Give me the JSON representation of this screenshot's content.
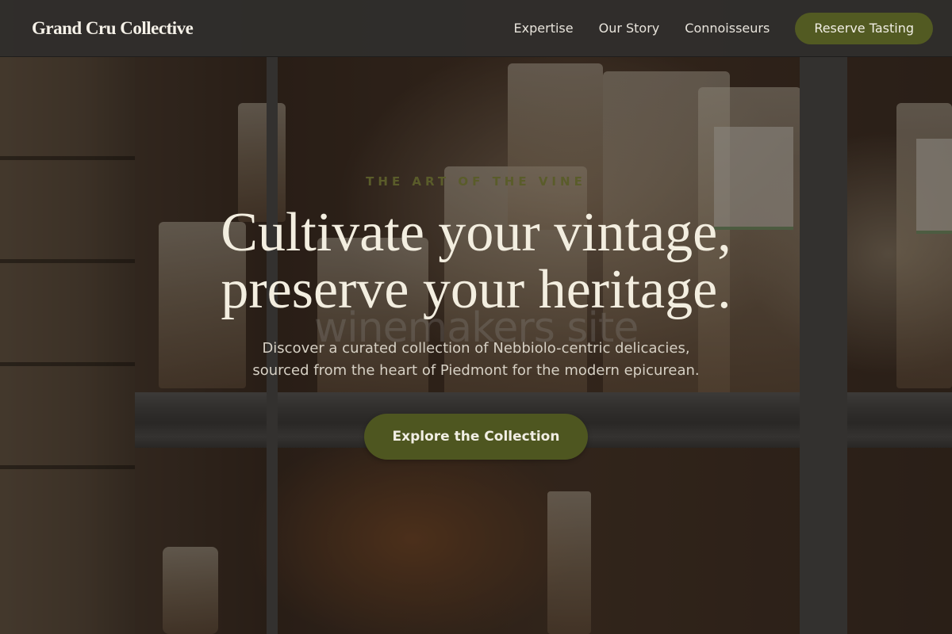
{
  "header": {
    "brand": "Grand Cru Collective",
    "nav": [
      {
        "label": "Expertise"
      },
      {
        "label": "Our Story"
      },
      {
        "label": "Connoisseurs"
      }
    ],
    "cta_label": "Reserve Tasting"
  },
  "hero": {
    "eyebrow": "THE ART OF THE VINE",
    "headline_line1": "Cultivate your vintage,",
    "headline_line2": "preserve your heritage.",
    "ghost_text": "winemakers site",
    "subtext_line1": "Discover a curated collection of Nebbiolo-centric delicacies,",
    "subtext_line2": "sourced from the heart of Piedmont for the modern epicurean.",
    "cta_label": "Explore the Collection"
  },
  "colors": {
    "accent": "#525a22",
    "header_bg": "#302e2c",
    "headline": "#f3eee0"
  }
}
